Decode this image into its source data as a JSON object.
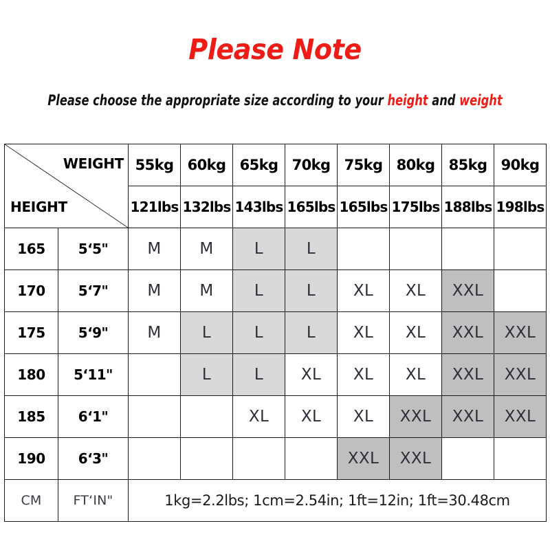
{
  "header": {
    "title": "Please Note",
    "subtitle_prefix": "Please choose the appropriate size according to your ",
    "subtitle_highlight_1": "height",
    "subtitle_middle": " and ",
    "subtitle_highlight_2": "weight"
  },
  "colors": {
    "title_red": "#ee1c16",
    "fill_l": "#d9d9d9",
    "fill_xxl": "#bfbfbf",
    "border": "#1a1a1a",
    "size_text": "#2e2e38"
  },
  "table": {
    "corner": {
      "weight_label": "WEIGHT",
      "height_label": "HEIGHT"
    },
    "weight_kg": [
      "55kg",
      "60kg",
      "65kg",
      "70kg",
      "75kg",
      "80kg",
      "85kg",
      "90kg"
    ],
    "weight_lbs": [
      "121lbs",
      "132lbs",
      "143lbs",
      "165lbs",
      "165lbs",
      "175lbs",
      "188lbs",
      "198lbs"
    ],
    "rows": [
      {
        "height_cm": "165",
        "height_ft": "5‘5\"",
        "sizes": [
          "M",
          "M",
          "L",
          "L",
          "",
          "",
          "",
          ""
        ]
      },
      {
        "height_cm": "170",
        "height_ft": "5‘7\"",
        "sizes": [
          "M",
          "M",
          "L",
          "L",
          "XL",
          "XL",
          "XXL",
          ""
        ]
      },
      {
        "height_cm": "175",
        "height_ft": "5‘9\"",
        "sizes": [
          "M",
          "L",
          "L",
          "L",
          "XL",
          "XL",
          "XXL",
          "XXL"
        ]
      },
      {
        "height_cm": "180",
        "height_ft": "5‘11\"",
        "sizes": [
          "",
          "L",
          "L",
          "XL",
          "XL",
          "XL",
          "XXL",
          "XXL"
        ]
      },
      {
        "height_cm": "185",
        "height_ft": "6‘1\"",
        "sizes": [
          "",
          "",
          "XL",
          "XL",
          "XL",
          "XXL",
          "XXL",
          "XXL"
        ]
      },
      {
        "height_cm": "190",
        "height_ft": "6‘3\"",
        "sizes": [
          "",
          "",
          "",
          "",
          "XXL",
          "XXL",
          "",
          ""
        ]
      }
    ],
    "footer": {
      "cm_label": "CM",
      "ft_label": "FT‘IN\"",
      "conversion_note": "1kg=2.2lbs; 1cm=2.54in; 1ft=12in; 1ft=30.48cm"
    }
  }
}
